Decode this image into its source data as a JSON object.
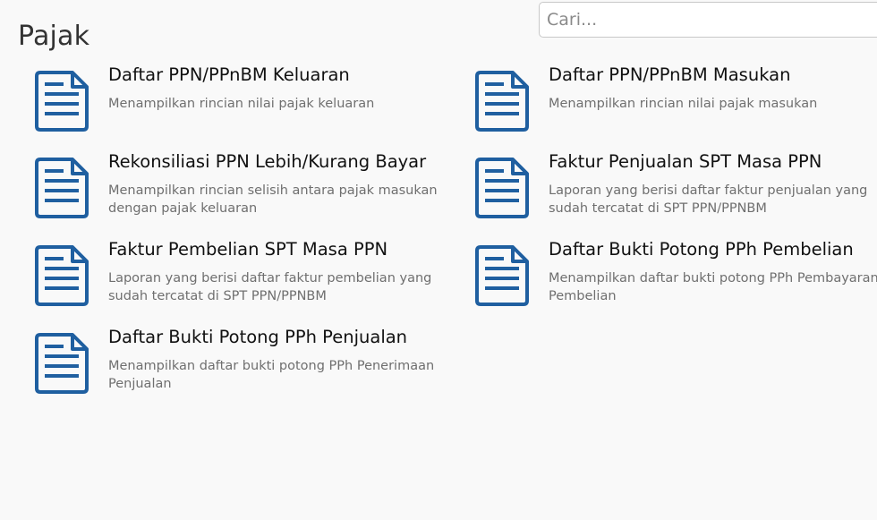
{
  "page": {
    "title": "Pajak"
  },
  "search": {
    "placeholder": "Cari..."
  },
  "icon": {
    "name": "document-icon",
    "color": "#1f5fa0"
  },
  "items": [
    {
      "title": "Daftar PPN/PPnBM Keluaran",
      "description": "Menampilkan rincian nilai pajak keluaran"
    },
    {
      "title": "Daftar PPN/PPnBM Masukan",
      "description": "Menampilkan rincian nilai pajak masukan"
    },
    {
      "title": "Rekonsiliasi PPN Lebih/Kurang Bayar",
      "description": "Menampilkan rincian selisih antara pajak masukan dengan pajak keluaran"
    },
    {
      "title": "Faktur Penjualan SPT Masa PPN",
      "description": "Laporan yang berisi daftar faktur penjualan yang sudah tercatat di SPT PPN/PPNBM"
    },
    {
      "title": "Faktur Pembelian SPT Masa PPN",
      "description": "Laporan yang berisi daftar faktur pembelian yang sudah tercatat di SPT PPN/PPNBM"
    },
    {
      "title": "Daftar Bukti Potong PPh Pembelian",
      "description": "Menampilkan daftar bukti potong PPh Pembayaran Pembelian"
    },
    {
      "title": "Daftar Bukti Potong PPh Penjualan",
      "description": "Menampilkan daftar bukti potong PPh Penerimaan Penjualan"
    }
  ]
}
